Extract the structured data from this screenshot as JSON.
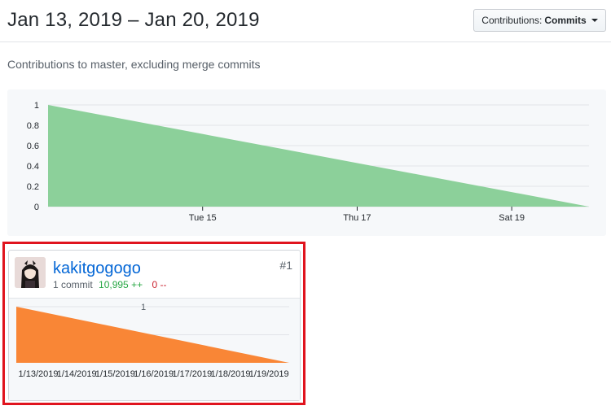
{
  "header": {
    "date_range": "Jan 13, 2019 – Jan 20, 2019",
    "dropdown_label": "Contributions:",
    "dropdown_value": "Commits"
  },
  "subtitle": "Contributions to master, excluding merge commits",
  "chart_data": [
    {
      "type": "area",
      "series": [
        {
          "values": [
            1,
            0
          ]
        }
      ],
      "x": [
        "2019-01-13",
        "2019-01-20"
      ],
      "x_tick_labels": [
        "Tue 15",
        "Thu 17",
        "Sat 19"
      ],
      "x_tick_positions": [
        "2019-01-15",
        "2019-01-17",
        "2019-01-19"
      ],
      "y_tick_labels": [
        "1",
        "0.8",
        "0.6",
        "0.4",
        "0.2",
        "0"
      ],
      "ylim": [
        0,
        1
      ],
      "grid": true,
      "color": "#8cd09a"
    },
    {
      "type": "area",
      "series": [
        {
          "values": [
            1,
            0
          ]
        }
      ],
      "x": [
        "2019-01-13",
        "2019-01-20"
      ],
      "x_tick_labels": [
        "1/13/2019",
        "1/14/2019",
        "1/15/2019",
        "1/16/2019",
        "1/17/2019",
        "1/18/2019",
        "1/19/2019"
      ],
      "y_tick_labels": [
        "1"
      ],
      "ylim": [
        0,
        1
      ],
      "grid": true,
      "color": "#f98636"
    }
  ],
  "contributor": {
    "username": "kakitgogogo",
    "commits": "1 commit",
    "additions": "10,995 ++",
    "deletions": "0 --",
    "rank": "#1"
  }
}
